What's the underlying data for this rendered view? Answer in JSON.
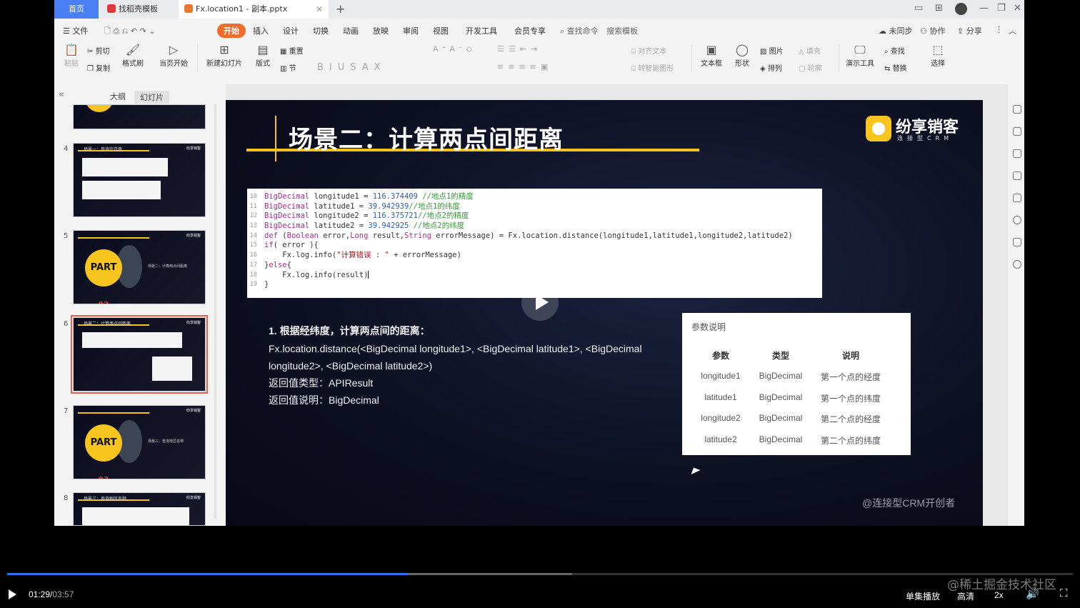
{
  "tabs": {
    "home": "首页",
    "template": "找稻壳模板",
    "file": "Fx.location1 - 副本.pptx"
  },
  "menu": {
    "file": "文件",
    "items": [
      "开始",
      "插入",
      "设计",
      "切换",
      "动画",
      "放映",
      "审阅",
      "视图",
      "开发工具",
      "会员专享"
    ],
    "active_index": 0,
    "search_cmd": "查找命令",
    "search_tpl": "搜索模板",
    "sync": "未同步",
    "collab": "协作",
    "share": "分享"
  },
  "ribbon": {
    "paste": "粘贴",
    "cut": "剪切",
    "copy": "复制",
    "format_painter": "格式刷",
    "play_from_current": "当页开始",
    "new_slide": "新建幻灯片",
    "layout": "版式",
    "reset": "重置",
    "section": "节",
    "align_text": "对齐文本",
    "convert_smartart": "转智能图形",
    "textbox": "文本框",
    "shapes": "形状",
    "picture": "图片",
    "arrange": "排列",
    "fill": "填充",
    "outline": "轮廓",
    "presenter_tools": "演示工具",
    "find": "查找",
    "replace": "替换",
    "select": "选择"
  },
  "panel": {
    "outline_tab": "大纲",
    "slides_tab": "幻灯片",
    "thumbs": [
      {
        "num": "4",
        "title": "场景一：查询空白值"
      },
      {
        "num": "5",
        "part": "PART",
        "part_num": "02",
        "title": "场景二：计算两点间距离"
      },
      {
        "num": "6",
        "title": "场景二：计算两点间距离",
        "selected": true
      },
      {
        "num": "7",
        "part": "PART",
        "part_num": "03",
        "title": "场景三：查询地区名称"
      },
      {
        "num": "8",
        "title": "场景三：查询地区名称"
      }
    ],
    "thumb_logo": "纷享销客"
  },
  "slide": {
    "title": "场景二：计算两点间距离",
    "brand_name": "纷享销客",
    "brand_sub": "连接型CRM",
    "code_lines": [
      {
        "n": "10",
        "text": "BigDecimal longitude1 = 116.374409 //地点1的精度"
      },
      {
        "n": "11",
        "text": "BigDecimal latitude1 = 39.942939//地点1的纬度"
      },
      {
        "n": "12",
        "text": "BigDecimal longitude2 = 116.375721//地点2的精度"
      },
      {
        "n": "13",
        "text": "BigDecimal latitude2 = 39.942925 //地点2的纬度"
      },
      {
        "n": "14",
        "text": "def (Boolean error,Long result,String errorMessage) = Fx.location.distance(longitude1,latitude1,longitude2,latitude2)"
      },
      {
        "n": "15",
        "text": "if( error ){"
      },
      {
        "n": "16",
        "text": "    Fx.log.info(\"计算错误 : \" + errorMessage)"
      },
      {
        "n": "17",
        "text": "}else{"
      },
      {
        "n": "18",
        "text": "    Fx.log.info(result)"
      },
      {
        "n": "19",
        "text": "}"
      }
    ],
    "desc_heading": "1. 根据经纬度，计算两点间的距离：",
    "desc_lines": [
      "Fx.location.distance(<BigDecimal longitude1>, <BigDecimal latitude1>, <BigDecimal",
      "longitude2>, <BigDecimal latitude2>)",
      "返回值类型：APIResult",
      "返回值说明：BigDecimal"
    ],
    "param_table": {
      "title": "参数说明",
      "headers": [
        "参数",
        "类型",
        "说明"
      ],
      "rows": [
        [
          "longitude1",
          "BigDecimal",
          "第一个点的经度"
        ],
        [
          "latitude1",
          "BigDecimal",
          "第一个点的纬度"
        ],
        [
          "longitude2",
          "BigDecimal",
          "第二个点的经度"
        ],
        [
          "latitude2",
          "BigDecimal",
          "第二个点的纬度"
        ]
      ]
    },
    "watermark": "@连接型CRM开创者"
  },
  "player": {
    "current_time": "01:29",
    "separator": "/",
    "duration": "03:57",
    "progress": 0.376,
    "buffered": 0.53,
    "playlist_mode": "单集播放",
    "quality": "高清",
    "speed": "2x"
  },
  "site_watermark": "@稀土掘金技术社区",
  "colors": {
    "accent_orange": "#ef6d2c",
    "home_tab_blue": "#4b7ff5",
    "slide_gold": "#f6c21c",
    "progress_blue": "#2d6ff0"
  }
}
